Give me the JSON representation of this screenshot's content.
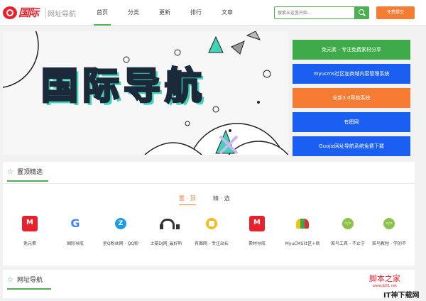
{
  "header": {
    "brand": "国际",
    "sub": "网址导航",
    "nav": [
      "首页",
      "分类",
      "更新",
      "排行",
      "文章"
    ],
    "active_nav": 0,
    "search_placeholder": "搜索从这里开始...",
    "submit_label": "免费提交"
  },
  "banner": {
    "title": "国际导航"
  },
  "side_links": [
    {
      "label": "免元素 - 专注免费素材分享",
      "color": "#3faa49"
    },
    {
      "label": "myucms社区加商城内容管理系统",
      "color": "#1a5ff2"
    },
    {
      "label": "全新3.0导航系统",
      "color": "#f57c32"
    },
    {
      "label": "有图网",
      "color": "#1a5ff2"
    },
    {
      "label": "Guojiz网址导航系统免费下载",
      "color": "#1a5ff2"
    }
  ],
  "top_panel": {
    "title": "置顶精选",
    "tabs": [
      "置 · 顶",
      "精 · 选"
    ],
    "active_tab": 0,
    "sites": [
      {
        "label": "免元素",
        "icon": "ic-red"
      },
      {
        "label": "国际导航",
        "icon": "ic-google"
      },
      {
        "label": "星Q粉丝网 - QQ粉",
        "icon": "ic-qz"
      },
      {
        "label": "土豪DJ网_最好听",
        "icon": "ic-phone"
      },
      {
        "label": "有图网 - 专注站长",
        "icon": "ic-ytw"
      },
      {
        "label": "素材导航",
        "icon": "ic-red"
      },
      {
        "label": "MyuCMS社区+商",
        "icon": "ic-ms"
      },
      {
        "label": "菜鸟工具 - 不止于",
        "icon": "ic-cn"
      },
      {
        "label": "菜鸟教程 - 学的不",
        "icon": "ic-cn"
      }
    ]
  },
  "bottom_panel": {
    "title": "网址导航"
  },
  "watermarks": {
    "jb51": "脚本之家",
    "jb51_url": "www.jb51.net",
    "downloader": "IT神下载网"
  }
}
